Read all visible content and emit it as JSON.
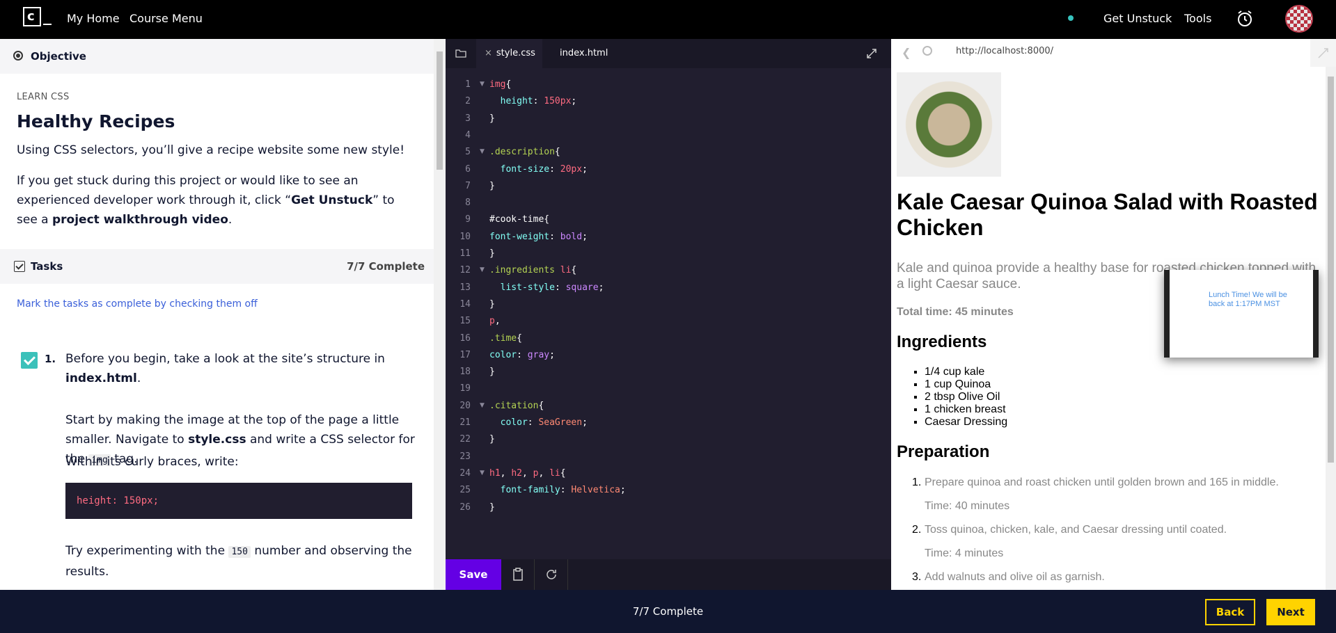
{
  "nav": {
    "my_home": "My Home",
    "course_menu": "Course Menu",
    "get_unstuck": "Get Unstuck",
    "tools": "Tools",
    "logo_letter": "c"
  },
  "left": {
    "objective_title": "Objective",
    "course_kicker": "LEARN CSS",
    "lesson_title": "Healthy Recipes",
    "intro": "Using CSS selectors, you’ll give a recipe website some new style!",
    "stuck_1": "If you get stuck during this project or would like to see an experienced developer work through it, click “",
    "stuck_bold_1": "Get Unstuck",
    "stuck_2": "” to see a ",
    "stuck_bold_2": "project walkthrough video",
    "stuck_3": ".",
    "tasks_title": "Tasks",
    "tasks_complete": "7/7 Complete",
    "tasks_hint": "Mark the tasks as complete by checking them off",
    "task1": {
      "number": "1.",
      "p1_text": "Before you begin, take a look at the site’s structure in ",
      "p1_bold": "index.html",
      "p1_end": ".",
      "p2_a": "Start by making the image at the top of the page a little smaller. Navigate to ",
      "p2_bold": "style.css",
      "p2_b": " and write a CSS selector for the ",
      "p2_code": "img",
      "p2_c": " tag.",
      "p3": "Within its curly braces, write:",
      "code": "height: 150px;",
      "p4_a": "Try experimenting with the ",
      "p4_code": "150",
      "p4_b": " number and observing the results."
    }
  },
  "editor": {
    "tabs": [
      {
        "label": "style.css",
        "close": "×"
      },
      {
        "label": "index.html"
      }
    ],
    "save_label": "Save",
    "lines": [
      {
        "n": "1",
        "fold": true,
        "tokens": [
          [
            "t-tag",
            "img"
          ],
          [
            "",
            "{"
          ]
        ]
      },
      {
        "n": "2",
        "fold": false,
        "tokens": [
          [
            "",
            "  "
          ],
          [
            "t-prop",
            "height"
          ],
          [
            "",
            ": "
          ],
          [
            "t-num",
            "150px"
          ],
          [
            "",
            ";"
          ]
        ]
      },
      {
        "n": "3",
        "fold": false,
        "tokens": [
          [
            "",
            "}"
          ]
        ]
      },
      {
        "n": "4",
        "fold": false,
        "tokens": []
      },
      {
        "n": "5",
        "fold": true,
        "tokens": [
          [
            "t-kw",
            ".description"
          ],
          [
            "",
            "{"
          ]
        ]
      },
      {
        "n": "6",
        "fold": false,
        "tokens": [
          [
            "",
            "  "
          ],
          [
            "t-prop",
            "font-size"
          ],
          [
            "",
            ": "
          ],
          [
            "t-num",
            "20px"
          ],
          [
            "",
            ";"
          ]
        ]
      },
      {
        "n": "7",
        "fold": false,
        "tokens": [
          [
            "",
            "}"
          ]
        ]
      },
      {
        "n": "8",
        "fold": false,
        "tokens": []
      },
      {
        "n": "9",
        "fold": false,
        "tokens": [
          [
            "t-id",
            "#cook-time"
          ],
          [
            "",
            "{"
          ]
        ]
      },
      {
        "n": "10",
        "fold": false,
        "tokens": [
          [
            "t-prop",
            "font-weight"
          ],
          [
            "",
            ": "
          ],
          [
            "t-val",
            "bold"
          ],
          [
            "",
            ";"
          ]
        ]
      },
      {
        "n": "11",
        "fold": false,
        "tokens": [
          [
            "",
            "}"
          ]
        ]
      },
      {
        "n": "12",
        "fold": true,
        "tokens": [
          [
            "t-kw",
            ".ingredients"
          ],
          [
            "",
            " "
          ],
          [
            "t-tag",
            "li"
          ],
          [
            "",
            "{"
          ]
        ]
      },
      {
        "n": "13",
        "fold": false,
        "tokens": [
          [
            "",
            "  "
          ],
          [
            "t-prop",
            "list-style"
          ],
          [
            "",
            ": "
          ],
          [
            "t-val",
            "square"
          ],
          [
            "",
            ";"
          ]
        ]
      },
      {
        "n": "14",
        "fold": false,
        "tokens": [
          [
            "",
            "}"
          ]
        ]
      },
      {
        "n": "15",
        "fold": false,
        "tokens": [
          [
            "t-tag",
            "p"
          ],
          [
            "",
            ","
          ]
        ]
      },
      {
        "n": "16",
        "fold": false,
        "tokens": [
          [
            "t-kw",
            ".time"
          ],
          [
            "",
            "{"
          ]
        ]
      },
      {
        "n": "17",
        "fold": false,
        "tokens": [
          [
            "t-prop",
            "color"
          ],
          [
            "",
            ": "
          ],
          [
            "t-val",
            "gray"
          ],
          [
            "",
            ";"
          ]
        ]
      },
      {
        "n": "18",
        "fold": false,
        "tokens": [
          [
            "",
            "}"
          ]
        ]
      },
      {
        "n": "19",
        "fold": false,
        "tokens": []
      },
      {
        "n": "20",
        "fold": true,
        "tokens": [
          [
            "t-kw",
            ".citation"
          ],
          [
            "",
            "{"
          ]
        ]
      },
      {
        "n": "21",
        "fold": false,
        "tokens": [
          [
            "",
            "  "
          ],
          [
            "t-prop",
            "color"
          ],
          [
            "",
            ": "
          ],
          [
            "t-str",
            "SeaGreen"
          ],
          [
            "",
            ";"
          ]
        ]
      },
      {
        "n": "22",
        "fold": false,
        "tokens": [
          [
            "",
            "}"
          ]
        ]
      },
      {
        "n": "23",
        "fold": false,
        "tokens": []
      },
      {
        "n": "24",
        "fold": true,
        "tokens": [
          [
            "t-tag",
            "h1"
          ],
          [
            "",
            ", "
          ],
          [
            "t-tag",
            "h2"
          ],
          [
            "",
            ", "
          ],
          [
            "t-tag",
            "p"
          ],
          [
            "",
            ", "
          ],
          [
            "t-tag",
            "li"
          ],
          [
            "",
            "{"
          ]
        ]
      },
      {
        "n": "25",
        "fold": false,
        "tokens": [
          [
            "",
            "  "
          ],
          [
            "t-prop",
            "font-family"
          ],
          [
            "",
            ": "
          ],
          [
            "t-str",
            "Helvetica"
          ],
          [
            "",
            ";"
          ]
        ]
      },
      {
        "n": "26",
        "fold": false,
        "tokens": [
          [
            "",
            "}"
          ]
        ]
      }
    ]
  },
  "browser": {
    "url": "http://localhost:8000/",
    "title": "Kale Caesar Quinoa Salad with Roasted Chicken",
    "description": "Kale and quinoa provide a healthy base for roasted chicken topped with a light Caesar sauce.",
    "total_time": "Total time: 45 minutes",
    "ingredients_heading": "Ingredients",
    "ingredients": [
      "1/4 cup kale",
      "1 cup Quinoa",
      "2 tbsp Olive Oil",
      "1 chicken breast",
      "Caesar Dressing"
    ],
    "preparation_heading": "Preparation",
    "steps": [
      {
        "n": "1.",
        "text": "Prepare quinoa and roast chicken until golden brown and 165 in middle.",
        "time": "Time: 40 minutes"
      },
      {
        "n": "2.",
        "text": "Toss quinoa, chicken, kale, and Caesar dressing until coated.",
        "time": "Time: 4 minutes"
      },
      {
        "n": "3.",
        "text": "Add walnuts and olive oil as garnish."
      }
    ],
    "popup_text": "Lunch Time! We will be back at 1:17PM MST"
  },
  "bottom": {
    "progress": "7/7 Complete",
    "back_label": "Back",
    "next_label": "Next"
  },
  "colors": {
    "accent": "#6400e4",
    "nav_yellow": "#ffd300",
    "check_teal": "#3bc1ba",
    "link_blue": "#3a5fd9",
    "editor_bg": "#211e2f"
  }
}
